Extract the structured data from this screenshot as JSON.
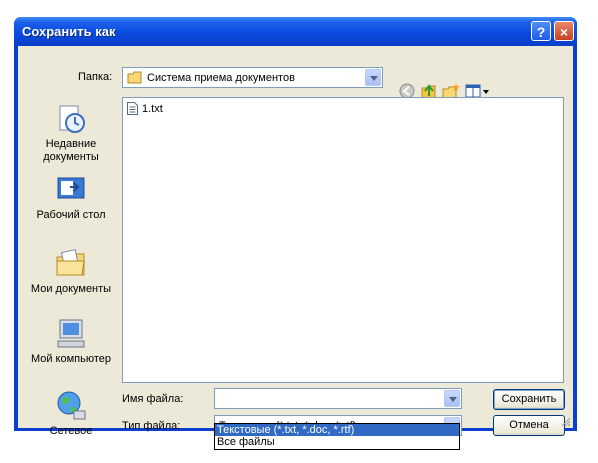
{
  "dialog": {
    "title": "Сохранить как",
    "help_glyph": "?",
    "close_glyph": "×"
  },
  "folder_bar": {
    "label": "Папка:",
    "current": "Система приема документов",
    "icons": [
      "back-icon",
      "up-folder-icon",
      "new-folder-icon",
      "view-menu-icon"
    ]
  },
  "places": [
    {
      "label": "Недавние документы",
      "icon": "recent-documents-icon"
    },
    {
      "label": "Рабочий стол",
      "icon": "desktop-icon"
    },
    {
      "label": "Мои документы",
      "icon": "my-documents-icon"
    },
    {
      "label": "Мой компьютер",
      "icon": "my-computer-icon"
    },
    {
      "label": "Сетевое",
      "icon": "network-icon"
    }
  ],
  "files": [
    {
      "name": "1.txt",
      "icon": "text-file-icon"
    }
  ],
  "filename": {
    "label": "Имя файла:",
    "value": ""
  },
  "filetype": {
    "label": "Тип файла:",
    "value": "Текстовые (*.txt, *.doc, *.rtf)",
    "options": [
      {
        "label": "Текстовые (*.txt, *.doc, *.rtf)",
        "selected": true
      },
      {
        "label": "Все файлы",
        "selected": false
      }
    ]
  },
  "buttons": {
    "save": "Сохранить",
    "cancel": "Отмена"
  },
  "colors": {
    "titlebar": "#0a4be0",
    "dialog_face": "#ece9d8",
    "selection": "#316ac5",
    "close_button": "#c5431e"
  }
}
